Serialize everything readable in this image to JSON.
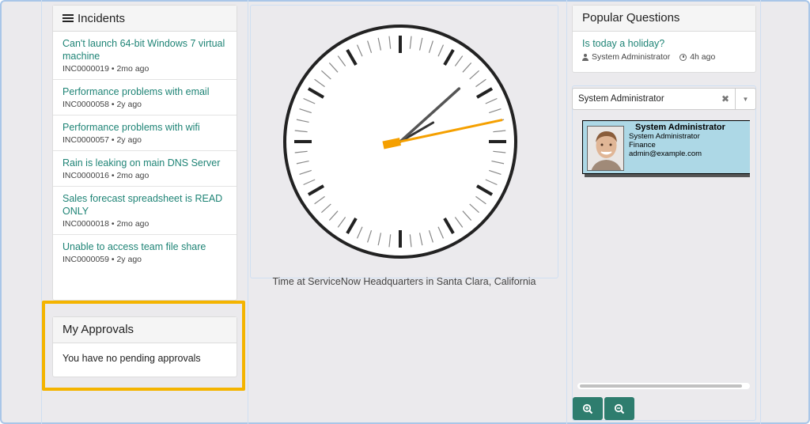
{
  "incidents": {
    "title": "Incidents",
    "items": [
      {
        "title": "Can't launch 64-bit Windows 7 virtual machine",
        "meta": "INC0000019 • 2mo ago"
      },
      {
        "title": "Performance problems with email",
        "meta": "INC0000058 • 2y ago"
      },
      {
        "title": "Performance problems with wifi",
        "meta": "INC0000057 • 2y ago"
      },
      {
        "title": "Rain is leaking on main DNS Server",
        "meta": "INC0000016 • 2mo ago"
      },
      {
        "title": "Sales forecast spreadsheet is READ ONLY",
        "meta": "INC0000018 • 2mo ago"
      },
      {
        "title": "Unable to access team file share",
        "meta": "INC0000059 • 2y ago"
      }
    ]
  },
  "approvals": {
    "title": "My Approvals",
    "empty_text": "You have no pending approvals"
  },
  "clock": {
    "caption": "Time at ServiceNow Headquarters in Santa Clara, California",
    "hour_hand_angle_deg": 60,
    "minute_hand_angle_deg": 48,
    "second_hand_angle_deg": 78,
    "second_hand_color": "#f5a000"
  },
  "popular": {
    "title": "Popular Questions",
    "question": "Is today a holiday?",
    "author": "System Administrator",
    "age": "4h ago"
  },
  "user_select": {
    "value": "System Administrator",
    "clear_icon": "times-icon",
    "arrow_icon": "caret-down-icon"
  },
  "user_card": {
    "name": "System Administrator",
    "title": "System Administrator",
    "department": "Finance",
    "email": "admin@example.com",
    "background": "#add8e6"
  },
  "zoom": {
    "in_icon": "zoom-in-icon",
    "out_icon": "zoom-out-icon"
  },
  "colors": {
    "accent": "#1f8476",
    "button": "#2e7d6e",
    "highlight": "#f4b400"
  }
}
